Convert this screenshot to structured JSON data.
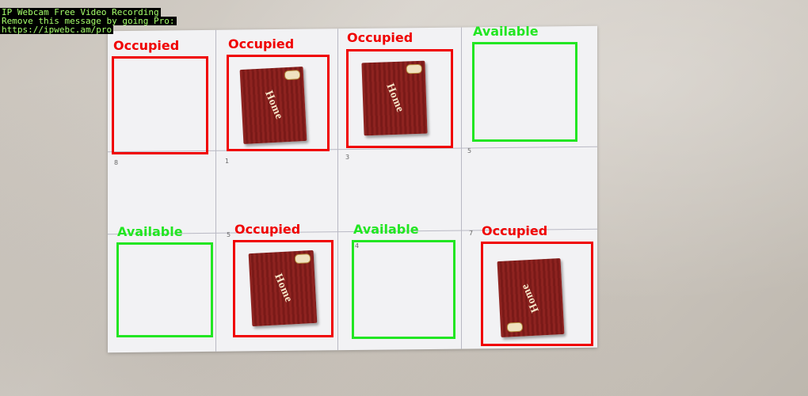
{
  "watermark": {
    "line1": "IP Webcam Free Video Recording",
    "line2": "Remove this message by going Pro:",
    "line3": "https://ipwebc.am/pro"
  },
  "brand_text": "Home",
  "colors": {
    "occupied": "#f00000",
    "available": "#22e622"
  },
  "slots": [
    {
      "status": "Occupied",
      "number": "8"
    },
    {
      "status": "Occupied",
      "number": "1"
    },
    {
      "status": "Occupied",
      "number": "3"
    },
    {
      "status": "Available",
      "number": "5"
    },
    {
      "status": "Available",
      "number": ""
    },
    {
      "status": "Occupied",
      "number": "5"
    },
    {
      "status": "Available",
      "number": "4"
    },
    {
      "status": "Occupied",
      "number": "7"
    }
  ]
}
